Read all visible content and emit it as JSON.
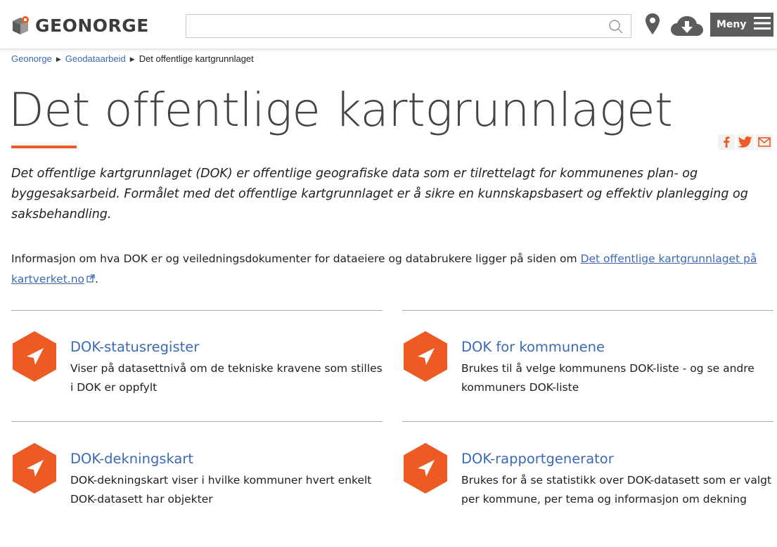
{
  "header": {
    "logo_text": "GEONORGE",
    "search_placeholder": "",
    "menu_label": "Meny"
  },
  "breadcrumb": {
    "items": [
      "Geonorge",
      "Geodataarbeid"
    ],
    "current": "Det offentlige kartgrunnlaget"
  },
  "page": {
    "title": "Det offentlige kartgrunnlaget",
    "intro": "Det offentlige kartgrunnlaget (DOK) er offentlige geografiske data som er tilrettelagt for kommunenes plan- og byggesaksarbeid. Formålet med det offentlige kartgrunnlaget er å sikre en kunnskapsbasert og effektiv planlegging og saksbehandling.",
    "info_before": "Informasjon om hva DOK er og veiledningsdokumenter for dataeiere og databrukere ligger på siden om ",
    "info_link": "Det offentlige kartgrunnlaget på kartverket.no",
    "info_after": "."
  },
  "cards": [
    {
      "title": "DOK-statusregister",
      "description": "Viser på datasettnivå om de tekniske kravene som stilles i DOK er oppfylt"
    },
    {
      "title": "DOK for kommunene",
      "description": "Brukes til å velge kommunens DOK-liste - og se andre kommuners DOK-liste"
    },
    {
      "title": "DOK-dekningskart",
      "description": "DOK-dekningskart viser i hvilke kommuner hvert enkelt DOK-datasett har objekter"
    },
    {
      "title": "DOK-rapportgenerator",
      "description": "Brukes for å se statistikk over DOK-datasett som er valgt per kommune, per tema og informasjon om dekning"
    }
  ],
  "colors": {
    "accent": "#ee5a24",
    "link": "#3b6ab3",
    "menu_bg": "#5c5c5c"
  },
  "icons": [
    "geonorge-logo-icon",
    "search-icon",
    "map-pin-icon",
    "cloud-download-icon",
    "hamburger-icon",
    "facebook-icon",
    "twitter-icon",
    "email-icon",
    "external-link-icon",
    "navigation-arrow-icon"
  ]
}
